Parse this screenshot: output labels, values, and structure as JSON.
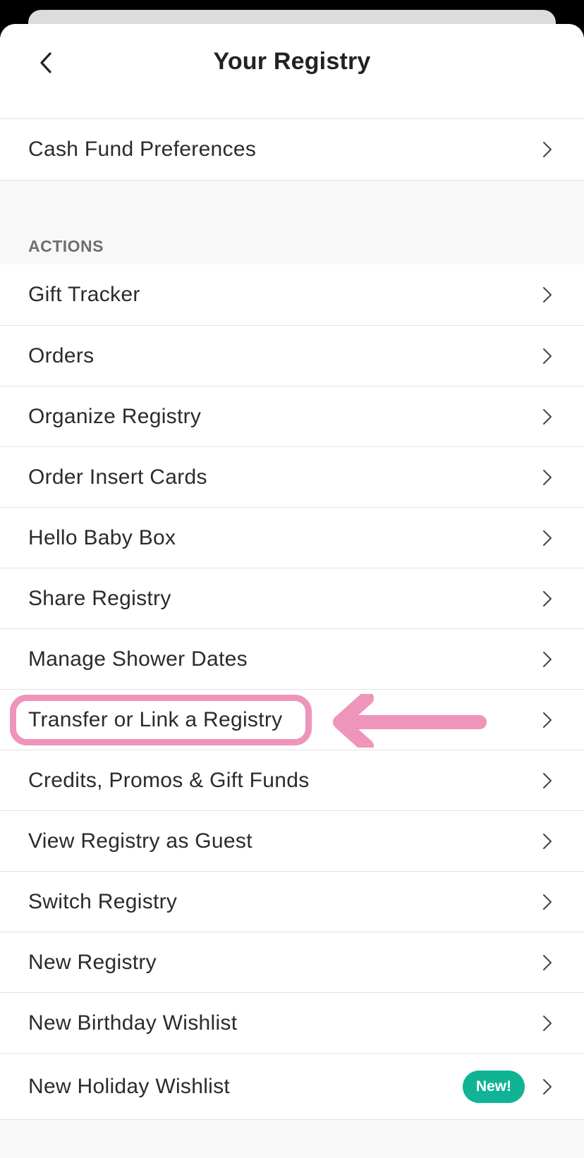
{
  "header": {
    "title": "Your Registry",
    "back_icon": "chevron-left-icon"
  },
  "top_items": [
    {
      "label": "Cash Fund Preferences"
    }
  ],
  "actions": {
    "section_label": "ACTIONS",
    "items": [
      {
        "label": "Gift Tracker"
      },
      {
        "label": "Orders"
      },
      {
        "label": "Organize Registry"
      },
      {
        "label": "Order Insert Cards"
      },
      {
        "label": "Hello Baby Box"
      },
      {
        "label": "Share Registry"
      },
      {
        "label": "Manage Shower Dates"
      },
      {
        "label": "Transfer or Link a Registry",
        "highlighted": true
      },
      {
        "label": "Credits, Promos & Gift Funds"
      },
      {
        "label": "View Registry as Guest"
      },
      {
        "label": "Switch Registry"
      },
      {
        "label": "New Registry"
      },
      {
        "label": "New Birthday Wishlist"
      },
      {
        "label": "New Holiday Wishlist",
        "badge": "New!"
      }
    ]
  },
  "colors": {
    "highlight": "#ef94ba",
    "badge": "#10b495",
    "divider": "#e2e2e2",
    "text": "#2b2b2b"
  }
}
